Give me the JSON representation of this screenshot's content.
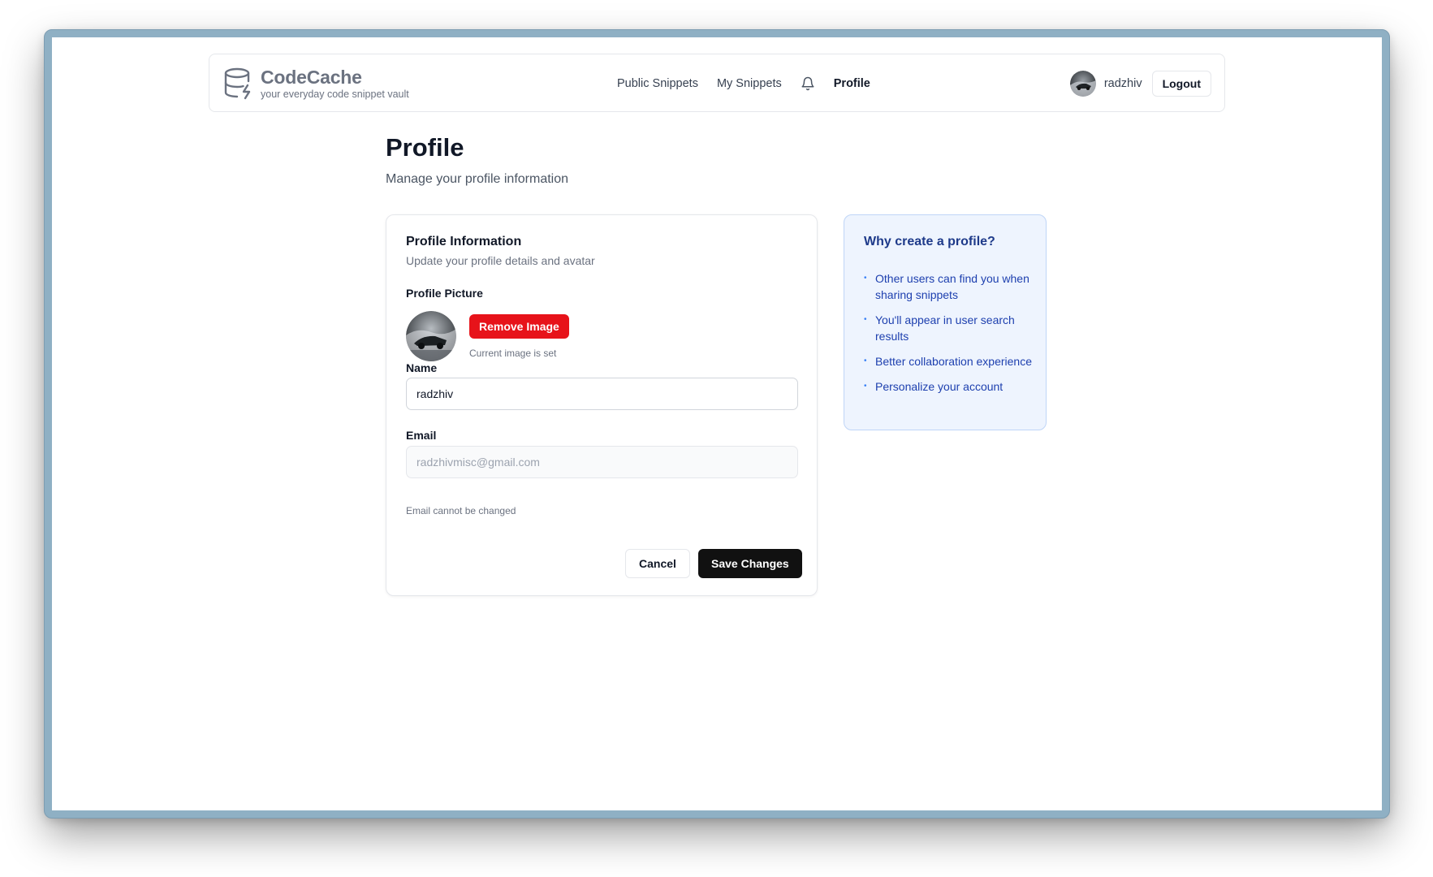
{
  "brand": {
    "name": "CodeCache",
    "tagline": "your everyday code snippet vault"
  },
  "nav": {
    "links": [
      {
        "label": "Public Snippets"
      },
      {
        "label": "My Snippets"
      },
      {
        "label": "Profile"
      }
    ],
    "notification_icon": "bell-icon",
    "username": "radzhiv",
    "logout_label": "Logout"
  },
  "page": {
    "title": "Profile",
    "subtitle": "Manage your profile information"
  },
  "profile_card": {
    "title": "Profile Information",
    "subtitle": "Update your profile details and avatar",
    "picture_label": "Profile Picture",
    "remove_image_label": "Remove Image",
    "image_note": "Current image is set",
    "name_label": "Name",
    "name_value": "radzhiv",
    "email_label": "Email",
    "email_value": "radzhivmisc@gmail.com",
    "email_note": "Email cannot be changed",
    "cancel_label": "Cancel",
    "save_label": "Save Changes"
  },
  "info_card": {
    "title": "Why create a profile?",
    "items": [
      "Other users can find you when sharing snippets",
      "You'll appear in user search results",
      "Better collaboration experience",
      "Personalize your account"
    ]
  },
  "colors": {
    "danger": "#e7131a",
    "primary_button": "#111111",
    "info_bg": "#eef4fe",
    "info_text": "#1e40af"
  }
}
